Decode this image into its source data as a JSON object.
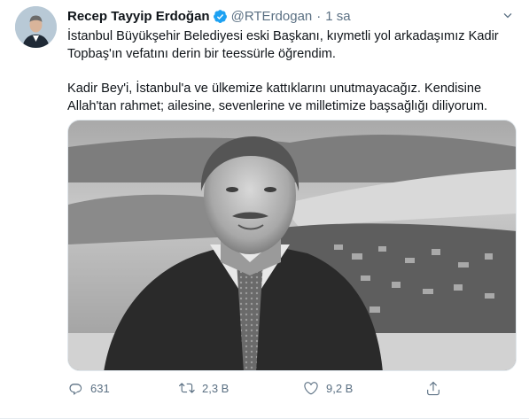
{
  "tweet": {
    "author_name": "Recep Tayyip Erdoğan",
    "handle": "@RTErdogan",
    "separator": "·",
    "time": "1 sa",
    "paragraph_1": "İstanbul Büyükşehir Belediyesi eski Başkanı, kıymetli yol arkadaşımız Kadir Topbaş'ın vefatını derin bir teessürle öğrendim.",
    "paragraph_2": "Kadir Bey'i, İstanbul'a ve ülkemize kattıklarını unutmayacağız. Kendisine Allah'tan rahmet; ailesine, sevenlerine ve milletimize başsağlığı diliyorum."
  },
  "actions": {
    "reply_count": "631",
    "retweet_count": "2,3 B",
    "like_count": "9,2 B"
  },
  "icons": {
    "verified": "verified-badge-icon",
    "more": "chevron-down-icon",
    "reply": "reply-icon",
    "retweet": "retweet-icon",
    "like": "heart-icon",
    "share": "share-icon"
  },
  "colors": {
    "verified": "#1da1f2",
    "secondary_text": "#5b7083",
    "primary_text": "#0f1419"
  }
}
